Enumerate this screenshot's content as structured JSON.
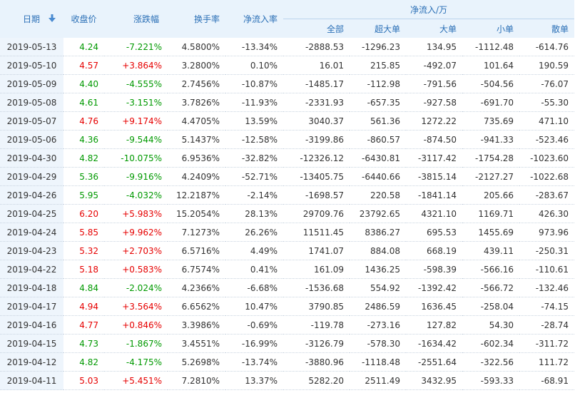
{
  "headers": {
    "date": "日期",
    "close": "收盘价",
    "change": "涨跌幅",
    "turnover": "换手率",
    "net_ratio": "净流入率",
    "net_flow_group": "净流入/万",
    "all": "全部",
    "super_large": "超大单",
    "large": "大单",
    "small": "小单",
    "retail": "散单"
  },
  "colors": {
    "up": "#e60000",
    "down": "#009900",
    "header_text": "#2a6fb6",
    "header_bg": "#e9f3fc"
  },
  "sort_icon": "sort-down-icon",
  "rows": [
    {
      "date": "2019-05-13",
      "close": "4.24",
      "change": "-7.221%",
      "turnover": "4.5800%",
      "net_ratio": "-13.34%",
      "all": "-2888.53",
      "super_large": "-1296.23",
      "large": "134.95",
      "small": "-1112.48",
      "retail": "-614.76",
      "dir": "down"
    },
    {
      "date": "2019-05-10",
      "close": "4.57",
      "change": "+3.864%",
      "turnover": "3.2800%",
      "net_ratio": "0.10%",
      "all": "16.01",
      "super_large": "215.85",
      "large": "-492.07",
      "small": "101.64",
      "retail": "190.59",
      "dir": "up"
    },
    {
      "date": "2019-05-09",
      "close": "4.40",
      "change": "-4.555%",
      "turnover": "2.7456%",
      "net_ratio": "-10.87%",
      "all": "-1485.17",
      "super_large": "-112.98",
      "large": "-791.56",
      "small": "-504.56",
      "retail": "-76.07",
      "dir": "down"
    },
    {
      "date": "2019-05-08",
      "close": "4.61",
      "change": "-3.151%",
      "turnover": "3.7826%",
      "net_ratio": "-11.93%",
      "all": "-2331.93",
      "super_large": "-657.35",
      "large": "-927.58",
      "small": "-691.70",
      "retail": "-55.30",
      "dir": "down"
    },
    {
      "date": "2019-05-07",
      "close": "4.76",
      "change": "+9.174%",
      "turnover": "4.4705%",
      "net_ratio": "13.59%",
      "all": "3040.37",
      "super_large": "561.36",
      "large": "1272.22",
      "small": "735.69",
      "retail": "471.10",
      "dir": "up"
    },
    {
      "date": "2019-05-06",
      "close": "4.36",
      "change": "-9.544%",
      "turnover": "5.1437%",
      "net_ratio": "-12.58%",
      "all": "-3199.86",
      "super_large": "-860.57",
      "large": "-874.50",
      "small": "-941.33",
      "retail": "-523.46",
      "dir": "down"
    },
    {
      "date": "2019-04-30",
      "close": "4.82",
      "change": "-10.075%",
      "turnover": "6.9536%",
      "net_ratio": "-32.82%",
      "all": "-12326.12",
      "super_large": "-6430.81",
      "large": "-3117.42",
      "small": "-1754.28",
      "retail": "-1023.60",
      "dir": "down"
    },
    {
      "date": "2019-04-29",
      "close": "5.36",
      "change": "-9.916%",
      "turnover": "4.2409%",
      "net_ratio": "-52.71%",
      "all": "-13405.75",
      "super_large": "-6440.66",
      "large": "-3815.14",
      "small": "-2127.27",
      "retail": "-1022.68",
      "dir": "down"
    },
    {
      "date": "2019-04-26",
      "close": "5.95",
      "change": "-4.032%",
      "turnover": "12.2187%",
      "net_ratio": "-2.14%",
      "all": "-1698.57",
      "super_large": "220.58",
      "large": "-1841.14",
      "small": "205.66",
      "retail": "-283.67",
      "dir": "down"
    },
    {
      "date": "2019-04-25",
      "close": "6.20",
      "change": "+5.983%",
      "turnover": "15.2054%",
      "net_ratio": "28.13%",
      "all": "29709.76",
      "super_large": "23792.65",
      "large": "4321.10",
      "small": "1169.71",
      "retail": "426.30",
      "dir": "up"
    },
    {
      "date": "2019-04-24",
      "close": "5.85",
      "change": "+9.962%",
      "turnover": "7.1273%",
      "net_ratio": "26.26%",
      "all": "11511.45",
      "super_large": "8386.27",
      "large": "695.53",
      "small": "1455.69",
      "retail": "973.96",
      "dir": "up"
    },
    {
      "date": "2019-04-23",
      "close": "5.32",
      "change": "+2.703%",
      "turnover": "6.5716%",
      "net_ratio": "4.49%",
      "all": "1741.07",
      "super_large": "884.08",
      "large": "668.19",
      "small": "439.11",
      "retail": "-250.31",
      "dir": "up"
    },
    {
      "date": "2019-04-22",
      "close": "5.18",
      "change": "+0.583%",
      "turnover": "6.7574%",
      "net_ratio": "0.41%",
      "all": "161.09",
      "super_large": "1436.25",
      "large": "-598.39",
      "small": "-566.16",
      "retail": "-110.61",
      "dir": "up"
    },
    {
      "date": "2019-04-18",
      "close": "4.84",
      "change": "-2.024%",
      "turnover": "4.2366%",
      "net_ratio": "-6.68%",
      "all": "-1536.68",
      "super_large": "554.92",
      "large": "-1392.42",
      "small": "-566.72",
      "retail": "-132.46",
      "dir": "down"
    },
    {
      "date": "2019-04-17",
      "close": "4.94",
      "change": "+3.564%",
      "turnover": "6.6562%",
      "net_ratio": "10.47%",
      "all": "3790.85",
      "super_large": "2486.59",
      "large": "1636.45",
      "small": "-258.04",
      "retail": "-74.15",
      "dir": "up"
    },
    {
      "date": "2019-04-16",
      "close": "4.77",
      "change": "+0.846%",
      "turnover": "3.3986%",
      "net_ratio": "-0.69%",
      "all": "-119.78",
      "super_large": "-273.16",
      "large": "127.82",
      "small": "54.30",
      "retail": "-28.74",
      "dir": "up"
    },
    {
      "date": "2019-04-15",
      "close": "4.73",
      "change": "-1.867%",
      "turnover": "3.4551%",
      "net_ratio": "-16.99%",
      "all": "-3126.79",
      "super_large": "-578.30",
      "large": "-1634.42",
      "small": "-602.34",
      "retail": "-311.72",
      "dir": "down"
    },
    {
      "date": "2019-04-12",
      "close": "4.82",
      "change": "-4.175%",
      "turnover": "5.2698%",
      "net_ratio": "-13.74%",
      "all": "-3880.96",
      "super_large": "-1118.48",
      "large": "-2551.64",
      "small": "-322.56",
      "retail": "111.72",
      "dir": "down"
    },
    {
      "date": "2019-04-11",
      "close": "5.03",
      "change": "+5.451%",
      "turnover": "7.2810%",
      "net_ratio": "13.37%",
      "all": "5282.20",
      "super_large": "2511.49",
      "large": "3432.95",
      "small": "-593.33",
      "retail": "-68.91",
      "dir": "up"
    }
  ]
}
